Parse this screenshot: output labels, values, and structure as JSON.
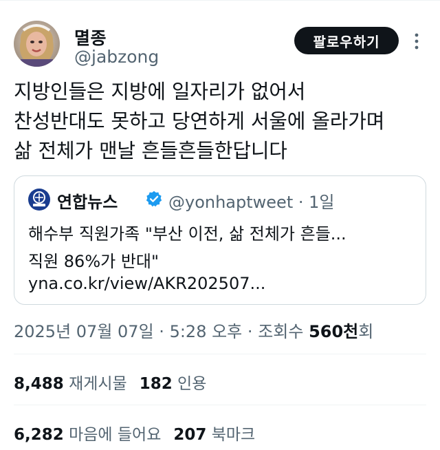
{
  "header": {
    "display_name": "멸종",
    "handle": "@jabzong",
    "follow_label": "팔로우하기"
  },
  "tweet": {
    "lines": [
      "지방인들은 지방에 일자리가 없어서",
      "찬성반대도 못하고 당연하게 서울에 올라가며",
      "삶 전체가 맨날 흔들흔들한답니다"
    ]
  },
  "quote": {
    "name": "연합뉴스",
    "handle": "@yonhaptweet",
    "separator": "·",
    "age": "1일",
    "lines": [
      "해수부 직원가족 \"부산 이전, 삶 전체가 흔들...",
      "직원 86%가 반대\"",
      "yna.co.kr/view/AKR202507..."
    ]
  },
  "meta": {
    "date": "2025년 07월 07일",
    "time": "5:28 오후",
    "views_label": "조회수",
    "views_value": "560천",
    "views_suffix": "회",
    "sep": "·"
  },
  "stats": {
    "retweets_count": "8,488",
    "retweets_label": "재게시물",
    "quotes_count": "182",
    "quotes_label": "인용",
    "likes_count": "6,282",
    "likes_label": "마음에 들어요",
    "bookmarks_count": "207",
    "bookmarks_label": "북마크"
  },
  "colors": {
    "text": "#0f1419",
    "secondary": "#536471",
    "border": "#cfd9de",
    "verified": "#1d9bf0",
    "follow_bg": "#0f1419"
  },
  "icons": {
    "more": "more-vertical-icon",
    "verified": "verified-badge-icon",
    "avatar": "avatar-image",
    "news_logo": "yonhap-logo-icon"
  }
}
